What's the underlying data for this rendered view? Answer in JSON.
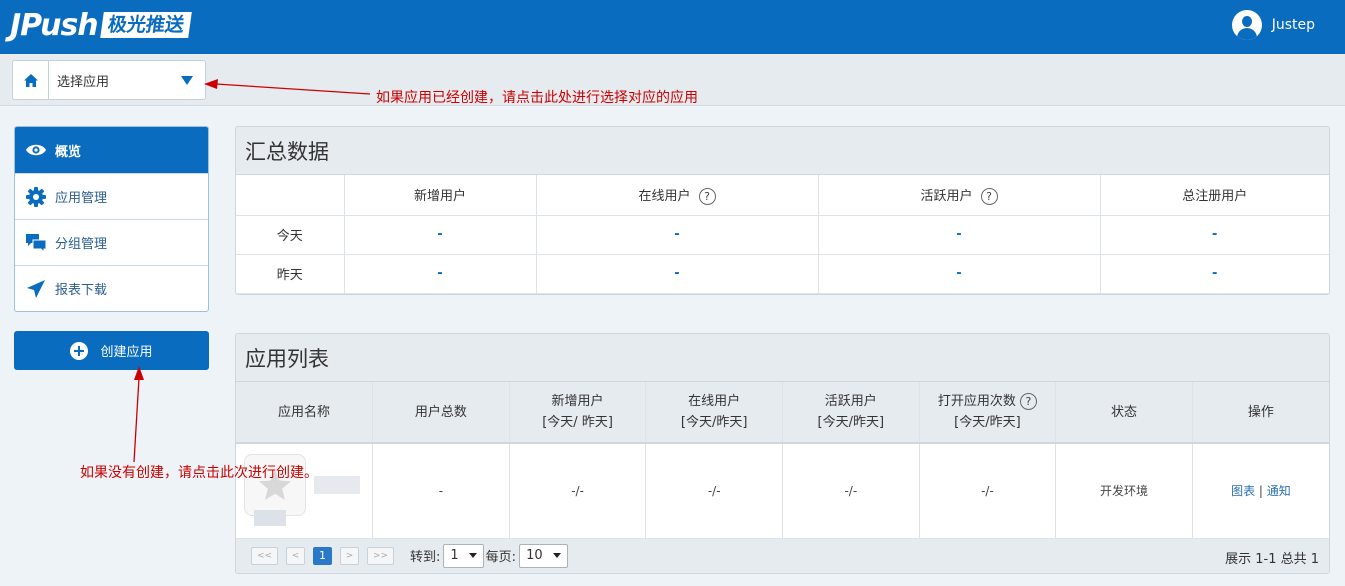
{
  "header": {
    "logo_word": "JPush",
    "logo_cn": "极光推送",
    "username": "Justep"
  },
  "appbar": {
    "select_label": "选择应用"
  },
  "annotations": {
    "top": "如果应用已经创建，请点击此处进行选择对应的应用",
    "bottom": "如果没有创建，请点击此次进行创建。"
  },
  "sidebar": {
    "items": [
      {
        "label": "概览",
        "icon": "eye-icon"
      },
      {
        "label": "应用管理",
        "icon": "gear-icon"
      },
      {
        "label": "分组管理",
        "icon": "chat-icon"
      },
      {
        "label": "报表下载",
        "icon": "send-icon"
      }
    ],
    "create_label": "创建应用"
  },
  "summary": {
    "title": "汇总数据",
    "headers": [
      "",
      "新增用户",
      "在线用户",
      "活跃用户",
      "总注册用户"
    ],
    "help": "?",
    "rows": [
      {
        "label": "今天",
        "values": [
          "-",
          "-",
          "-",
          "-"
        ]
      },
      {
        "label": "昨天",
        "values": [
          "-",
          "-",
          "-",
          "-"
        ]
      }
    ]
  },
  "applist": {
    "title": "应用列表",
    "headers": [
      {
        "l1": "应用名称",
        "l2": ""
      },
      {
        "l1": "用户总数",
        "l2": ""
      },
      {
        "l1": "新增用户",
        "l2": "[今天/ 昨天]"
      },
      {
        "l1": "在线用户",
        "l2": "[今天/昨天]"
      },
      {
        "l1": "活跃用户",
        "l2": "[今天/昨天]"
      },
      {
        "l1": "打开应用次数",
        "l2": "[今天/昨天]"
      },
      {
        "l1": "状态",
        "l2": ""
      },
      {
        "l1": "操作",
        "l2": ""
      }
    ],
    "row": {
      "total": "-",
      "new": "-/-",
      "online": "-/-",
      "active": "-/-",
      "opens": "-/-",
      "status": "开发环境",
      "op_chart": "图表",
      "op_sep": "|",
      "op_notify": "通知"
    }
  },
  "pager": {
    "first": "<<",
    "prev": "<",
    "current": "1",
    "next": ">",
    "last": ">>",
    "goto_label": "转到:",
    "goto_value": "1",
    "per_page_label": "每页:",
    "per_page_value": "10",
    "total_text": "展示 1-1 总共 1"
  },
  "colors": {
    "brand": "#0a6cbf",
    "annotation": "#cc0000"
  }
}
